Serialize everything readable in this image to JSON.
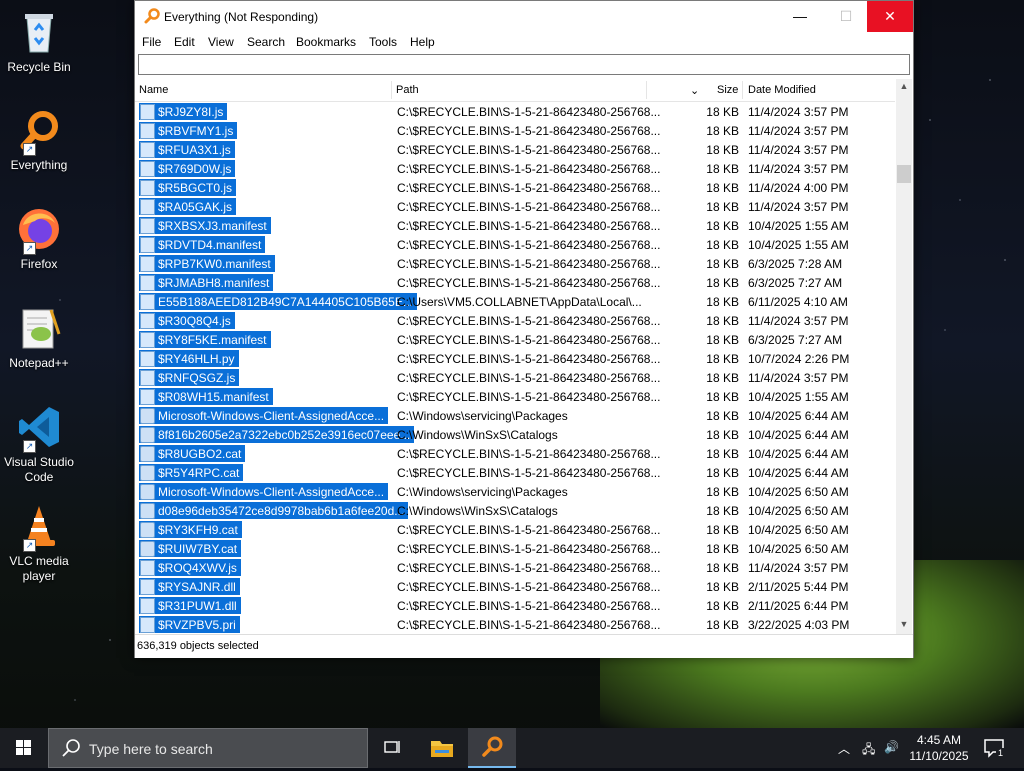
{
  "desktop": {
    "icons": [
      {
        "label": "Recycle Bin"
      },
      {
        "label": "Everything"
      },
      {
        "label": "Firefox"
      },
      {
        "label": "Notepad++"
      },
      {
        "label": "Visual Studio Code"
      },
      {
        "label": "VLC media player"
      }
    ]
  },
  "window": {
    "title": "Everything (Not Responding)",
    "menu": [
      "File",
      "Edit",
      "View",
      "Search",
      "Bookmarks",
      "Tools",
      "Help"
    ],
    "search_value": "",
    "columns": {
      "name": "Name",
      "path": "Path",
      "size": "Size",
      "date": "Date Modified"
    },
    "rows": [
      {
        "name": "$RJ9ZY8I.js",
        "path": "C:\\$RECYCLE.BIN\\S-1-5-21-86423480-256768...",
        "size": "18 KB",
        "date": "11/4/2024 3:57 PM",
        "icon": "script"
      },
      {
        "name": "$RBVFMY1.js",
        "path": "C:\\$RECYCLE.BIN\\S-1-5-21-86423480-256768...",
        "size": "18 KB",
        "date": "11/4/2024 3:57 PM",
        "icon": "script"
      },
      {
        "name": "$RFUA3X1.js",
        "path": "C:\\$RECYCLE.BIN\\S-1-5-21-86423480-256768...",
        "size": "18 KB",
        "date": "11/4/2024 3:57 PM",
        "icon": "script"
      },
      {
        "name": "$R769D0W.js",
        "path": "C:\\$RECYCLE.BIN\\S-1-5-21-86423480-256768...",
        "size": "18 KB",
        "date": "11/4/2024 3:57 PM",
        "icon": "script"
      },
      {
        "name": "$R5BGCT0.js",
        "path": "C:\\$RECYCLE.BIN\\S-1-5-21-86423480-256768...",
        "size": "18 KB",
        "date": "11/4/2024 4:00 PM",
        "icon": "script"
      },
      {
        "name": "$RA05GAK.js",
        "path": "C:\\$RECYCLE.BIN\\S-1-5-21-86423480-256768...",
        "size": "18 KB",
        "date": "11/4/2024 3:57 PM",
        "icon": "script"
      },
      {
        "name": "$RXBSXJ3.manifest",
        "path": "C:\\$RECYCLE.BIN\\S-1-5-21-86423480-256768...",
        "size": "18 KB",
        "date": "10/4/2025 1:55 AM",
        "icon": "file"
      },
      {
        "name": "$RDVTD4.manifest",
        "path": "C:\\$RECYCLE.BIN\\S-1-5-21-86423480-256768...",
        "size": "18 KB",
        "date": "10/4/2025 1:55 AM",
        "icon": "file"
      },
      {
        "name": "$RPB7KW0.manifest",
        "path": "C:\\$RECYCLE.BIN\\S-1-5-21-86423480-256768...",
        "size": "18 KB",
        "date": "6/3/2025 7:28 AM",
        "icon": "file"
      },
      {
        "name": "$RJMABH8.manifest",
        "path": "C:\\$RECYCLE.BIN\\S-1-5-21-86423480-256768...",
        "size": "18 KB",
        "date": "6/3/2025 7:27 AM",
        "icon": "file"
      },
      {
        "name": "E55B188AEED812B49C7A144405C105B65E...",
        "path": "C:\\Users\\VM5.COLLABNET\\AppData\\Local\\...",
        "size": "18 KB",
        "date": "6/11/2025 4:10 AM",
        "icon": "file"
      },
      {
        "name": "$R30Q8Q4.js",
        "path": "C:\\$RECYCLE.BIN\\S-1-5-21-86423480-256768...",
        "size": "18 KB",
        "date": "11/4/2024 3:57 PM",
        "icon": "script"
      },
      {
        "name": "$RY8F5KE.manifest",
        "path": "C:\\$RECYCLE.BIN\\S-1-5-21-86423480-256768...",
        "size": "18 KB",
        "date": "6/3/2025 7:27 AM",
        "icon": "file"
      },
      {
        "name": "$RY46HLH.py",
        "path": "C:\\$RECYCLE.BIN\\S-1-5-21-86423480-256768...",
        "size": "18 KB",
        "date": "10/7/2024 2:26 PM",
        "icon": "python"
      },
      {
        "name": "$RNFQSGZ.js",
        "path": "C:\\$RECYCLE.BIN\\S-1-5-21-86423480-256768...",
        "size": "18 KB",
        "date": "11/4/2024 3:57 PM",
        "icon": "script"
      },
      {
        "name": "$R08WH15.manifest",
        "path": "C:\\$RECYCLE.BIN\\S-1-5-21-86423480-256768...",
        "size": "18 KB",
        "date": "10/4/2025 1:55 AM",
        "icon": "file"
      },
      {
        "name": "Microsoft-Windows-Client-AssignedAcce...",
        "path": "C:\\Windows\\servicing\\Packages",
        "size": "18 KB",
        "date": "10/4/2025 6:44 AM",
        "icon": "package"
      },
      {
        "name": "8f816b2605e2a7322ebc0b252e3916ec07eee...",
        "path": "C:\\Windows\\WinSxS\\Catalogs",
        "size": "18 KB",
        "date": "10/4/2025 6:44 AM",
        "icon": "package"
      },
      {
        "name": "$R8UGBO2.cat",
        "path": "C:\\$RECYCLE.BIN\\S-1-5-21-86423480-256768...",
        "size": "18 KB",
        "date": "10/4/2025 6:44 AM",
        "icon": "package"
      },
      {
        "name": "$R5Y4RPC.cat",
        "path": "C:\\$RECYCLE.BIN\\S-1-5-21-86423480-256768...",
        "size": "18 KB",
        "date": "10/4/2025 6:44 AM",
        "icon": "package"
      },
      {
        "name": "Microsoft-Windows-Client-AssignedAcce...",
        "path": "C:\\Windows\\servicing\\Packages",
        "size": "18 KB",
        "date": "10/4/2025 6:50 AM",
        "icon": "package"
      },
      {
        "name": "d08e96deb35472ce8d9978bab6b1a6fee20d...",
        "path": "C:\\Windows\\WinSxS\\Catalogs",
        "size": "18 KB",
        "date": "10/4/2025 6:50 AM",
        "icon": "package"
      },
      {
        "name": "$RY3KFH9.cat",
        "path": "C:\\$RECYCLE.BIN\\S-1-5-21-86423480-256768...",
        "size": "18 KB",
        "date": "10/4/2025 6:50 AM",
        "icon": "package"
      },
      {
        "name": "$RUIW7BY.cat",
        "path": "C:\\$RECYCLE.BIN\\S-1-5-21-86423480-256768...",
        "size": "18 KB",
        "date": "10/4/2025 6:50 AM",
        "icon": "package"
      },
      {
        "name": "$ROQ4XWV.js",
        "path": "C:\\$RECYCLE.BIN\\S-1-5-21-86423480-256768...",
        "size": "18 KB",
        "date": "11/4/2024 3:57 PM",
        "icon": "script"
      },
      {
        "name": "$RYSAJNR.dll",
        "path": "C:\\$RECYCLE.BIN\\S-1-5-21-86423480-256768...",
        "size": "18 KB",
        "date": "2/11/2025 5:44 PM",
        "icon": "file"
      },
      {
        "name": "$R31PUW1.dll",
        "path": "C:\\$RECYCLE.BIN\\S-1-5-21-86423480-256768...",
        "size": "18 KB",
        "date": "2/11/2025 6:44 PM",
        "icon": "file"
      },
      {
        "name": "$RVZPBV5.pri",
        "path": "C:\\$RECYCLE.BIN\\S-1-5-21-86423480-256768...",
        "size": "18 KB",
        "date": "3/22/2025 4:03 PM",
        "icon": "file"
      }
    ],
    "status": "636,319 objects selected"
  },
  "taskbar": {
    "search_placeholder": "Type here to search",
    "time": "4:45 AM",
    "date": "11/10/2025",
    "notification_count": "1"
  },
  "colors": {
    "selection": "#0a6fd8",
    "close_button": "#e81123",
    "taskbar": "#1b1d22"
  }
}
